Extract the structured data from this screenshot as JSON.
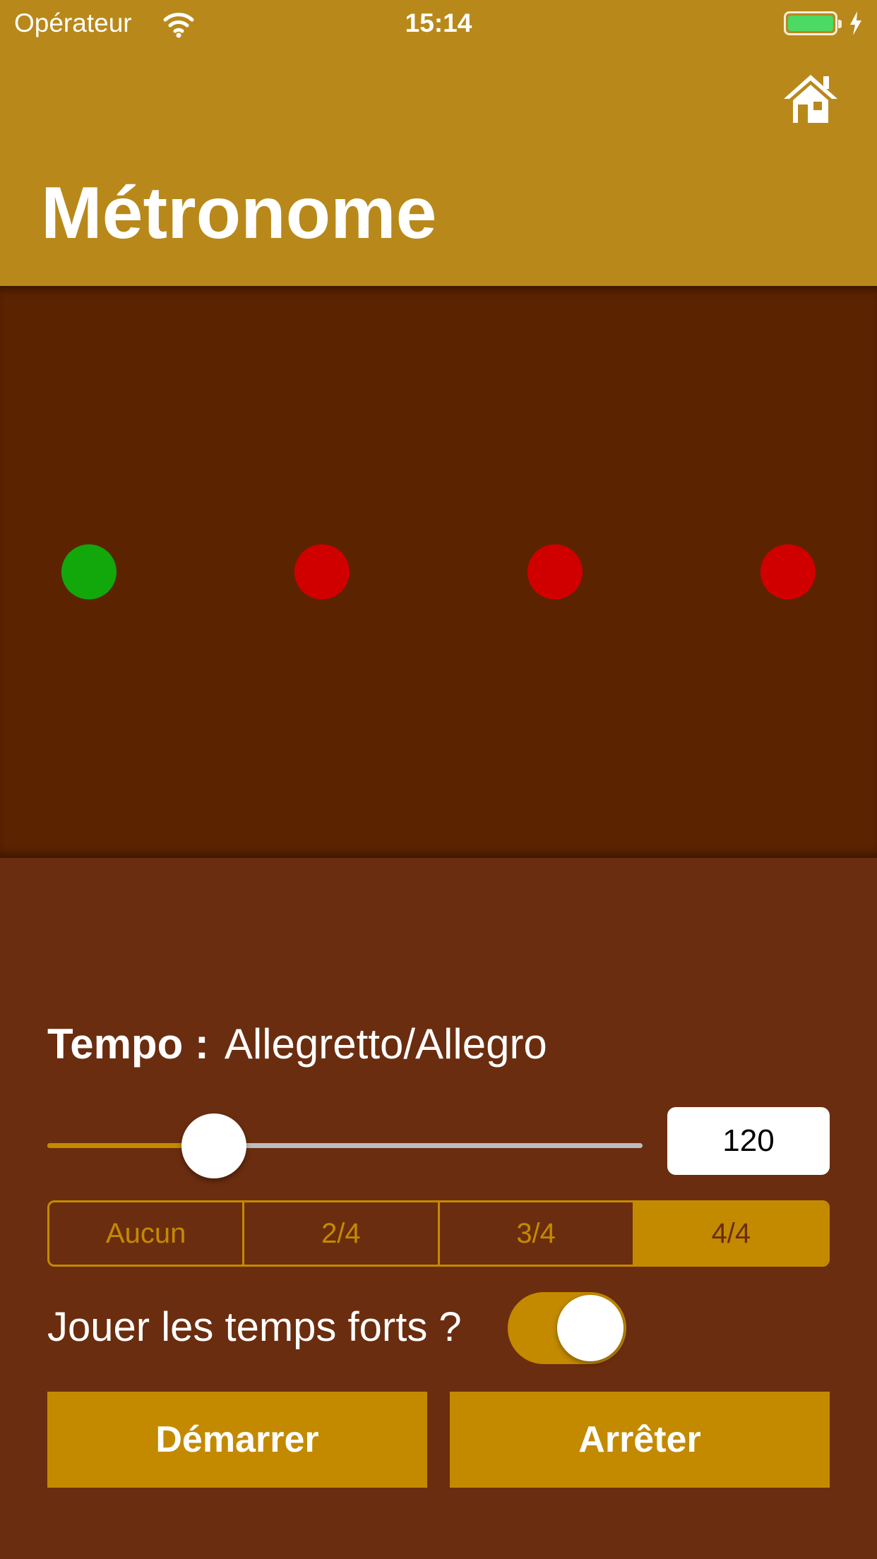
{
  "status_bar": {
    "carrier": "Opérateur",
    "time": "15:14"
  },
  "header": {
    "title": "Métronome",
    "home_icon": "home-icon"
  },
  "beat_indicators": [
    {
      "state": "active",
      "color": "#12A80B"
    },
    {
      "state": "inactive",
      "color": "#D10000"
    },
    {
      "state": "inactive",
      "color": "#D10000"
    },
    {
      "state": "inactive",
      "color": "#D10000"
    }
  ],
  "tempo": {
    "label": "Tempo :",
    "name": "Allegretto/Allegro",
    "bpm": "120",
    "slider_level": 0.28
  },
  "time_signature": {
    "options": [
      "Aucun",
      "2/4",
      "3/4",
      "4/4"
    ],
    "selected": "4/4"
  },
  "accent": {
    "label": "Jouer les temps forts ?",
    "enabled": true
  },
  "actions": {
    "start": "Démarrer",
    "stop": "Arrêter"
  },
  "colors": {
    "header": "#B8891A",
    "visual_bg": "#5C2300",
    "panel_bg": "#6B2D0F",
    "accent": "#C38A00",
    "beat_active": "#12A80B",
    "beat_inactive": "#D10000"
  }
}
